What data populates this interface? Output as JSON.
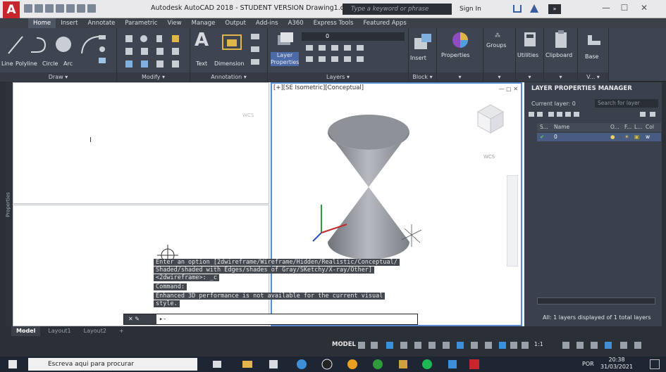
{
  "window": {
    "logo": "A",
    "title": "Autodesk AutoCAD 2018 - STUDENT VERSION    Drawing1.dwg",
    "search_placeholder": "Type a keyword or phrase",
    "sign_in": "Sign In",
    "overflow": "»"
  },
  "ribbon": {
    "tabs": [
      {
        "label": "Home",
        "active": true
      },
      {
        "label": "Insert"
      },
      {
        "label": "Annotate"
      },
      {
        "label": "Parametric"
      },
      {
        "label": "View"
      },
      {
        "label": "Manage"
      },
      {
        "label": "Output"
      },
      {
        "label": "Add-ins"
      },
      {
        "label": "A360"
      },
      {
        "label": "Express Tools"
      },
      {
        "label": "Featured Apps"
      }
    ],
    "draw": {
      "title": "Draw ▾",
      "tools": [
        "Line",
        "Polyline",
        "Circle",
        "Arc"
      ]
    },
    "modify": {
      "title": "Modify ▾"
    },
    "annotation": {
      "title": "Annotation ▾",
      "tools": [
        "Text",
        "Dimension"
      ]
    },
    "layers": {
      "title": "Layers ▾",
      "layer_properties": "Layer Properties",
      "layer_value": "0"
    },
    "block": {
      "title": "Block ▾",
      "insert": "Insert"
    },
    "properties": {
      "label": "Properties"
    },
    "groups": {
      "label": "Groups"
    },
    "utilities": {
      "label": "Utilities"
    },
    "clipboard": {
      "label": "Clipboard"
    },
    "base": {
      "label": "Base"
    }
  },
  "viewport": {
    "label": "[+][SE Isometric][Conceptual]",
    "wcs": "WCS",
    "props_label": "Properties"
  },
  "layer_manager": {
    "title": "LAYER PROPERTIES MANAGER",
    "current": "Current layer: 0",
    "search": "Search for layer",
    "columns": [
      "S...",
      "Name",
      "O...",
      "F...",
      "L...",
      "Col"
    ],
    "row_name": "0",
    "row_color": "w",
    "status": "All: 1 layers displayed of 1 total layers"
  },
  "command": {
    "history": [
      "Enter an option [2dwireframe/Wireframe/Hidden/Realistic/Conceptual/",
      "Shaded/shaded with Edges/shades of Gray/SKetchy/X-ray/Other]",
      "<2dwireframe>: _c",
      "Command:",
      "Enhanced 3D performance is not available for the current visual",
      "style."
    ],
    "tools": "✕ ✎",
    "prompt": "▸-"
  },
  "layouts": [
    "Model",
    "Layout1",
    "Layout2",
    "+"
  ],
  "status": {
    "model": "MODEL",
    "scale": "1:1"
  },
  "taskbar": {
    "search": "Escreva aqui para procurar",
    "lang": "POR",
    "time": "20:38",
    "date": "31/03/2021"
  }
}
